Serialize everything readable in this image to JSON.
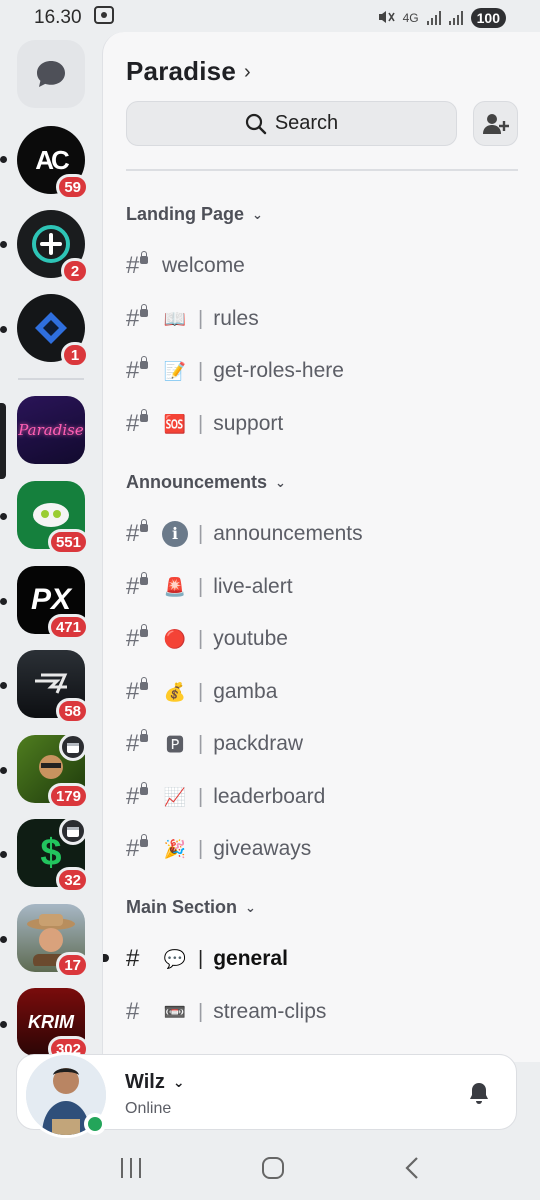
{
  "statusbar": {
    "time": "16.30",
    "network": "4G",
    "battery": "100"
  },
  "rail": {
    "servers": [
      {
        "label": "AC",
        "badge": "59"
      },
      {
        "label": "+",
        "badge": "2"
      },
      {
        "label": "◆",
        "badge": "1"
      },
      {
        "label": "Paradise",
        "badge": ""
      },
      {
        "label": "",
        "badge": "551"
      },
      {
        "label": "PX",
        "badge": "471"
      },
      {
        "label": "",
        "badge": "58"
      },
      {
        "label": "",
        "badge": "179"
      },
      {
        "label": "$",
        "badge": "32"
      },
      {
        "label": "",
        "badge": "17"
      },
      {
        "label": "KRIM",
        "badge": "302"
      }
    ]
  },
  "guild": {
    "name": "Paradise",
    "search_label": "Search"
  },
  "categories": [
    {
      "label": "Landing Page"
    },
    {
      "label": "Announcements"
    },
    {
      "label": "Main Section"
    }
  ],
  "channels": [
    {
      "name": "welcome",
      "emoji": ""
    },
    {
      "name": "rules",
      "emoji": "📖"
    },
    {
      "name": "get-roles-here",
      "emoji": "📝"
    },
    {
      "name": "support",
      "emoji": "🆘"
    },
    {
      "name": "announcements",
      "emoji": "ℹ"
    },
    {
      "name": "live-alert",
      "emoji": "🚨"
    },
    {
      "name": "youtube",
      "emoji": "🔴"
    },
    {
      "name": "gamba",
      "emoji": "💰"
    },
    {
      "name": "packdraw",
      "emoji": "🅿"
    },
    {
      "name": "leaderboard",
      "emoji": "📈"
    },
    {
      "name": "giveaways",
      "emoji": "🎉"
    },
    {
      "name": "general",
      "emoji": "💬"
    },
    {
      "name": "stream-clips",
      "emoji": "📼"
    }
  ],
  "separator": "|",
  "user": {
    "name": "Wilz",
    "status": "Online"
  },
  "colors": {
    "accent": "#da373c",
    "online": "#23a55a"
  }
}
